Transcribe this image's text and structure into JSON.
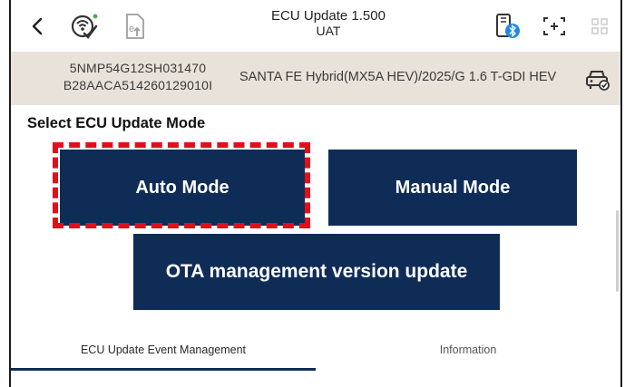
{
  "header": {
    "title": "ECU Update 1.500",
    "subtitle": "UAT",
    "icons": {
      "back": "chevron-left-icon",
      "wireless": "wireless-check-icon",
      "document": "document-upload-icon",
      "vci": "bluetooth-device-icon",
      "capture": "screen-capture-icon",
      "grid": "grid-menu-icon"
    }
  },
  "vehicle": {
    "vin_line1": "5NMP54G12SH031470",
    "vin_line2": "B28AACA514260129010I",
    "model": "SANTA FE Hybrid(MX5A HEV)/2025/G 1.6 T-GDI HEV"
  },
  "main": {
    "section_title": "Select ECU Update Mode",
    "buttons": {
      "auto": "Auto Mode",
      "manual": "Manual Mode",
      "ota": "OTA management version update"
    }
  },
  "tabs": [
    {
      "label": "ECU Update Event Management",
      "active": true
    },
    {
      "label": "Information",
      "active": false
    }
  ],
  "colors": {
    "button_bg": "#0f2c57",
    "vehicle_bar_bg": "#e8e2db",
    "highlight_border": "#e0101a",
    "accent_blue": "#1e88e5"
  }
}
